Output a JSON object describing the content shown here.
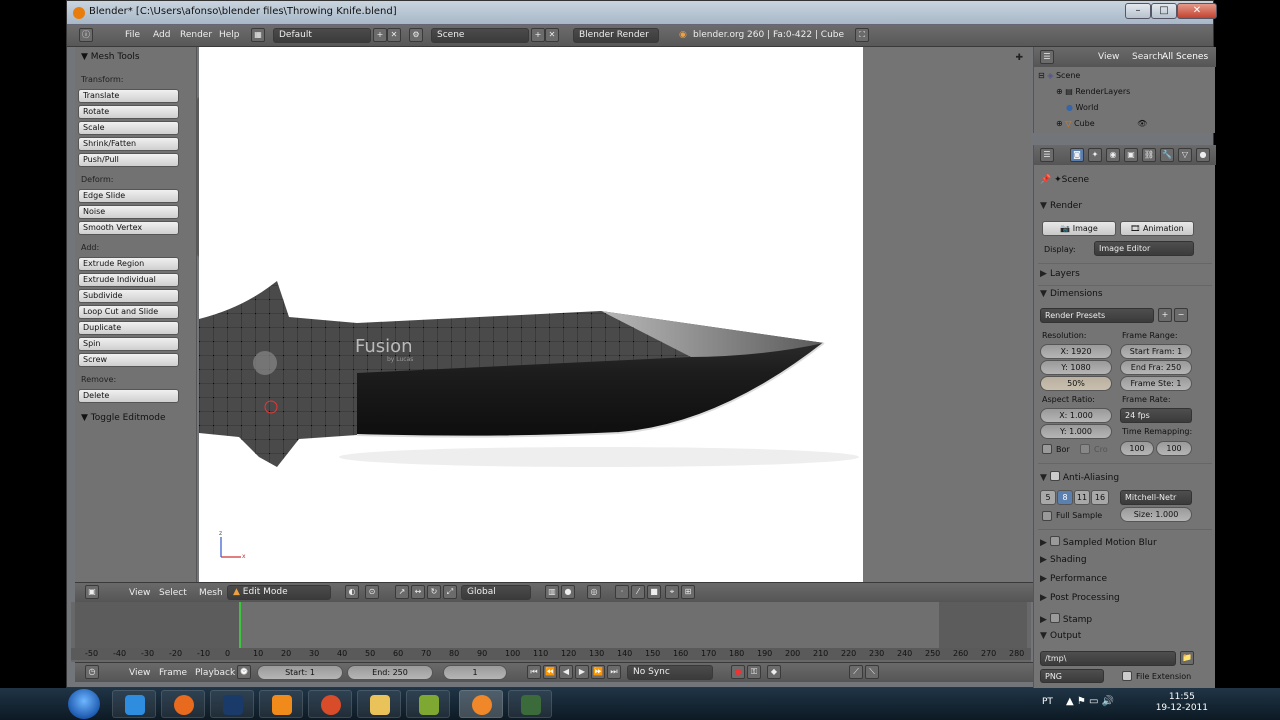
{
  "window": {
    "title": "Blender* [C:\\Users\\afonso\\blender files\\Throwing Knife.blend]",
    "controls": {
      "minimize": "–",
      "maximize": "□",
      "close": "✕"
    }
  },
  "menubar": {
    "items": [
      "File",
      "Add",
      "Render",
      "Help"
    ],
    "layout": "Default",
    "scene": "Scene",
    "engine": "Blender Render",
    "info": "blender.org 260 | Fa:0-422 | Cube"
  },
  "toolshelf": {
    "title": "Mesh Tools",
    "transform_label": "Transform:",
    "transform": [
      "Translate",
      "Rotate",
      "Scale",
      "Shrink/Fatten",
      "Push/Pull"
    ],
    "deform_label": "Deform:",
    "deform": [
      "Edge Slide",
      "Noise",
      "Smooth Vertex"
    ],
    "add_label": "Add:",
    "add": [
      "Extrude Region",
      "Extrude Individual",
      "Subdivide",
      "Loop Cut and Slide",
      "Duplicate",
      "Spin",
      "Screw"
    ],
    "remove_label": "Remove:",
    "remove": [
      "Delete"
    ],
    "toggle": "Toggle Editmode"
  },
  "viewport": {
    "watermark": "Fusion",
    "watermark_sub": "by Lucas",
    "axis_z": "z",
    "axis_x": "x"
  },
  "viewport_header": {
    "view": "View",
    "select": "Select",
    "mesh": "Mesh",
    "mode": "Edit Mode",
    "orientation": "Global"
  },
  "timeline": {
    "ticks": [
      "-50",
      "-40",
      "-30",
      "-20",
      "-10",
      "0",
      "10",
      "20",
      "30",
      "40",
      "50",
      "60",
      "70",
      "80",
      "90",
      "100",
      "110",
      "120",
      "130",
      "140",
      "150",
      "160",
      "170",
      "180",
      "190",
      "200",
      "210",
      "220",
      "230",
      "240",
      "250",
      "260",
      "270",
      "280"
    ],
    "view": "View",
    "frame": "Frame",
    "playback": "Playback",
    "start": "Start: 1",
    "end": "End: 250",
    "current": "1",
    "sync": "No Sync"
  },
  "outliner": {
    "view": "View",
    "search": "Search",
    "filter": "All Scenes",
    "rows": [
      "Scene",
      "RenderLayers",
      "World",
      "Cube"
    ]
  },
  "properties": {
    "context": "Scene",
    "render": {
      "title": "Render",
      "image": "Image",
      "animation": "Animation",
      "display_label": "Display:",
      "display": "Image Editor"
    },
    "layers": "Layers",
    "dimensions": {
      "title": "Dimensions",
      "presets": "Render Presets",
      "resolution_label": "Resolution:",
      "res_x": "X: 1920",
      "res_y": "Y: 1080",
      "res_pct": "50%",
      "frame_range_label": "Frame Range:",
      "start": "Start Fram: 1",
      "end": "End Fra: 250",
      "step": "Frame Ste: 1",
      "aspect_label": "Aspect Ratio:",
      "asp_x": "X: 1.000",
      "asp_y": "Y: 1.000",
      "frame_rate_label": "Frame Rate:",
      "fps": "24 fps",
      "remap_label": "Time Remapping:",
      "remap_old": "100",
      "remap_new": "100",
      "border": "Bor",
      "crop": "Cro"
    },
    "aa": {
      "title": "Anti-Aliasing",
      "samples": [
        "5",
        "8",
        "11",
        "16"
      ],
      "filter": "Mitchell-Netr",
      "full_sample": "Full Sample",
      "size": "Size: 1.000"
    },
    "motion_blur": "Sampled Motion Blur",
    "shading": "Shading",
    "performance": "Performance",
    "post": "Post Processing",
    "stamp": "Stamp",
    "output": {
      "title": "Output",
      "path": "/tmp\\",
      "format": "PNG",
      "file_ext": "File Extension"
    }
  },
  "taskbar": {
    "lang": "PT",
    "time": "11:55",
    "date": "19-12-2011"
  }
}
